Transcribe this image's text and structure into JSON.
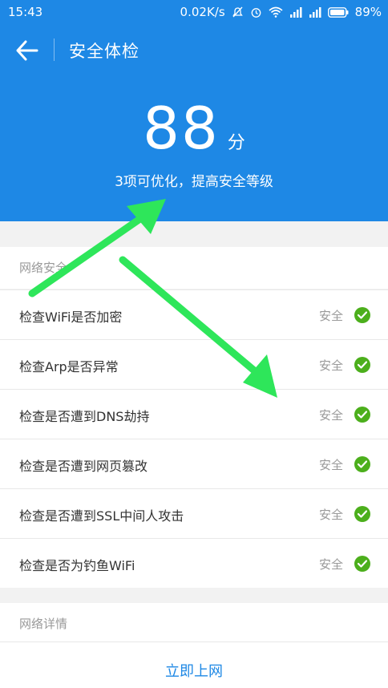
{
  "status_bar": {
    "time": "15:43",
    "speed": "0.02K/s",
    "battery": "89%"
  },
  "app_bar": {
    "title": "安全体检"
  },
  "score": {
    "value": "88",
    "unit": "分",
    "subtitle": "3项可优化，提高安全等级"
  },
  "sections": {
    "network_security": "网络安全",
    "network_details": "网络详情"
  },
  "checks": [
    {
      "label": "检查WiFi是否加密",
      "status": "安全"
    },
    {
      "label": "检查Arp是否异常",
      "status": "安全"
    },
    {
      "label": "检查是否遭到DNS劫持",
      "status": "安全"
    },
    {
      "label": "检查是否遭到网页篡改",
      "status": "安全"
    },
    {
      "label": "检查是否遭到SSL中间人攻击",
      "status": "安全"
    },
    {
      "label": "检查是否为钓鱼WiFi",
      "status": "安全"
    }
  ],
  "footer": {
    "action_label": "立即上网"
  },
  "colors": {
    "header_blue": "#1e88e5",
    "check_green": "#4caf1c",
    "annotation_arrow": "#2ee65a"
  }
}
